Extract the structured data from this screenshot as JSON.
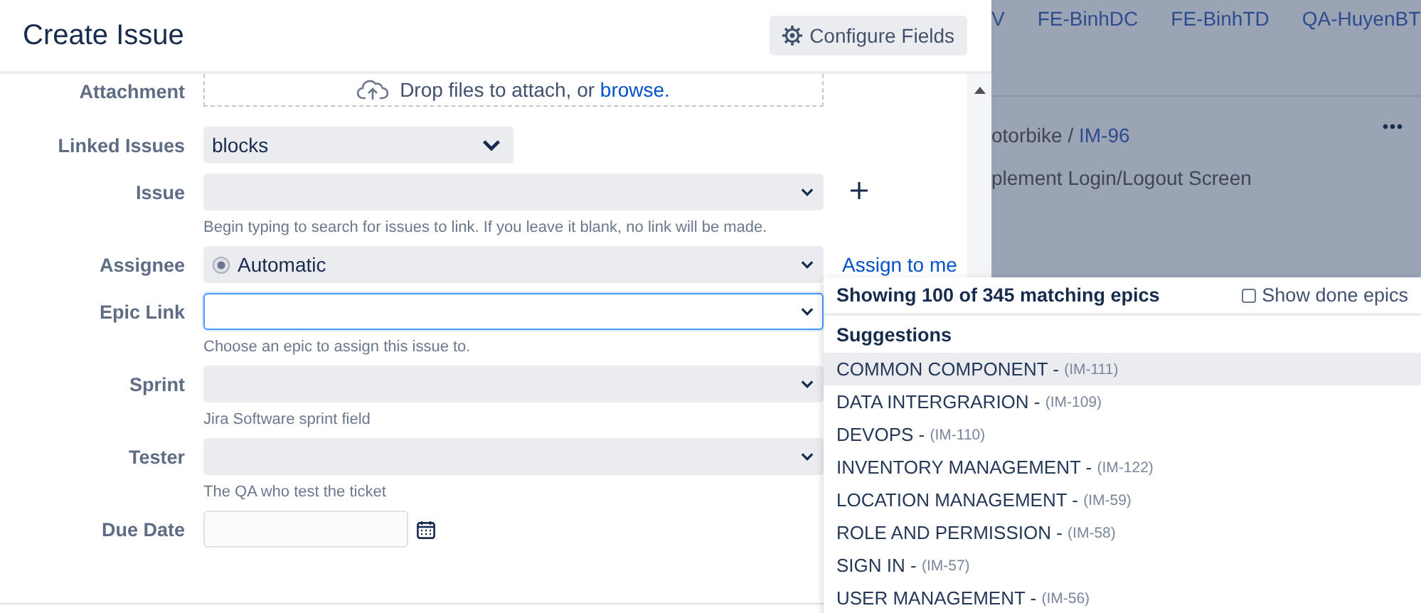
{
  "dialog": {
    "title": "Create Issue",
    "configure_button": "Configure Fields",
    "fields": [
      {
        "kind": "attachment",
        "label": "Attachment",
        "text": "Drop files to attach, or ",
        "link": "browse."
      },
      {
        "kind": "short_select",
        "label": "Linked Issues",
        "value": "blocks",
        "focused": false
      },
      {
        "kind": "select",
        "label": "Issue",
        "hint": "Begin typing to search for issues to link. If you leave it blank, no link will be made.",
        "add_button": true,
        "focused": false
      },
      {
        "kind": "select",
        "label": "Assignee",
        "value": "Automatic",
        "avatar": true,
        "extra_link": "Assign to me",
        "focused": false
      },
      {
        "kind": "select",
        "label": "Epic Link",
        "hint": "Choose an epic to assign this issue to.",
        "focused": true
      },
      {
        "kind": "select",
        "label": "Sprint",
        "hint": "Jira Software sprint field",
        "focused": false
      },
      {
        "kind": "select",
        "label": "Tester",
        "hint": "The QA who test the ticket",
        "focused": false
      },
      {
        "kind": "date",
        "label": "Due Date"
      }
    ]
  },
  "background": {
    "links": [
      "V",
      "FE-BinhDC",
      "FE-BinhTD",
      "QA-HuyenBT"
    ],
    "breadcrumb": "otorbike / ",
    "issue_key": "IM-96",
    "issue_title": "plement Login/Logout Screen"
  },
  "epic_dropdown": {
    "summary": "Showing 100 of 345 matching epics",
    "show_done": {
      "label": "Show done epics",
      "checked": false
    },
    "heading": "Suggestions",
    "items": [
      {
        "name": "COMMON COMPONENT - ",
        "key": "(IM-111)",
        "selected": true
      },
      {
        "name": "DATA INTERGRARION - ",
        "key": "(IM-109)",
        "selected": false
      },
      {
        "name": "DEVOPS - ",
        "key": "(IM-110)",
        "selected": false
      },
      {
        "name": "INVENTORY MANAGEMENT - ",
        "key": "(IM-122)",
        "selected": false
      },
      {
        "name": "LOCATION MANAGEMENT - ",
        "key": "(IM-59)",
        "selected": false
      },
      {
        "name": "ROLE AND PERMISSION - ",
        "key": "(IM-58)",
        "selected": false
      },
      {
        "name": "SIGN IN - ",
        "key": "(IM-57)",
        "selected": false
      },
      {
        "name": "USER MANAGEMENT - ",
        "key": "(IM-56)",
        "selected": false
      }
    ]
  }
}
